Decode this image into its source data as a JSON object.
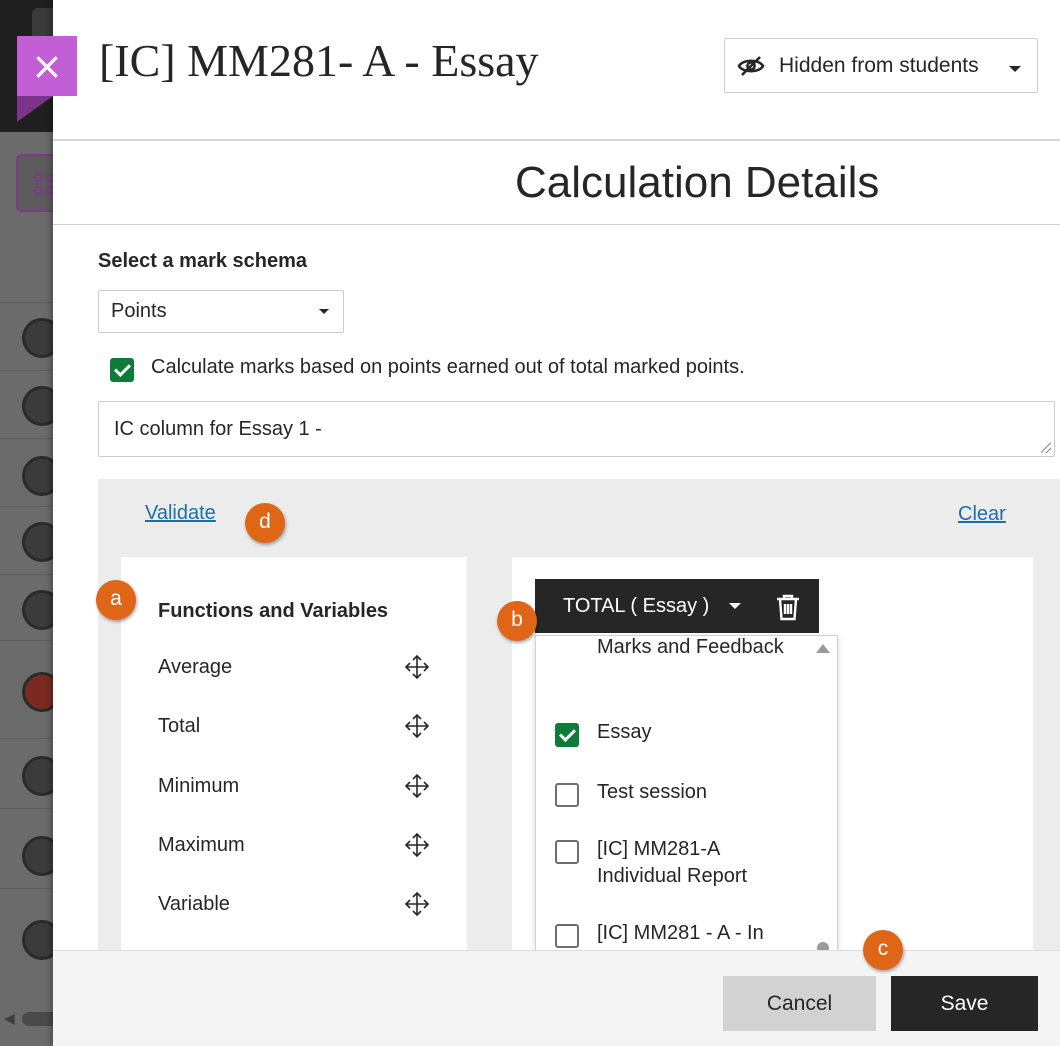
{
  "header": {
    "title": "[IC] MM281- A - Essay",
    "close_icon": "×",
    "visibility_label": "Hidden from students"
  },
  "section_title": "Calculation Details",
  "schema": {
    "label": "Select a mark schema",
    "selected": "Points"
  },
  "calculate_option": {
    "checked": true,
    "label": "Calculate marks based on points earned out of total marked points."
  },
  "description": {
    "value": "IC column for Essay 1 -"
  },
  "builder": {
    "validate_label": "Validate",
    "clear_label": "Clear",
    "functions_heading": "Functions and Variables",
    "functions": [
      {
        "label": "Average",
        "icon": "move-icon"
      },
      {
        "label": "Total",
        "icon": "move-icon"
      },
      {
        "label": "Minimum",
        "icon": "move-icon"
      },
      {
        "label": "Maximum",
        "icon": "move-icon"
      },
      {
        "label": "Variable",
        "icon": "move-icon"
      }
    ],
    "token": {
      "label": "TOTAL ( Essay )",
      "delete_icon": "trash-icon"
    },
    "dropdown": {
      "group_label": "Marks and Feedback",
      "options": [
        {
          "label": "Essay",
          "checked": true
        },
        {
          "label": "Test session",
          "checked": false
        },
        {
          "label": "[IC] MM281-A Individual Report",
          "checked": false
        },
        {
          "label": "[IC] MM281 - A - In",
          "checked": false
        }
      ]
    }
  },
  "footer": {
    "cancel_label": "Cancel",
    "save_label": "Save"
  },
  "callouts": {
    "a": "a",
    "b": "b",
    "c": "c",
    "d": "d"
  },
  "colors": {
    "accent_close": "#c25ed6",
    "checkbox_checked": "#0f7b38",
    "link": "#1b6ea8",
    "callout": "#e06617",
    "primary_button": "#262626"
  }
}
